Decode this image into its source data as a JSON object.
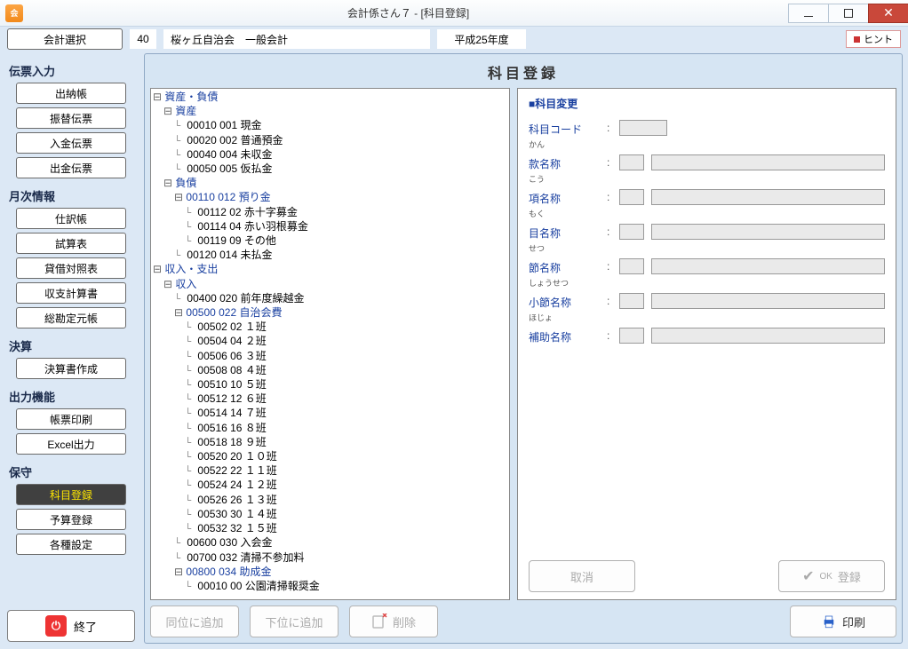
{
  "titlebar": {
    "title": "会計係さん７ - [科目登録]"
  },
  "toprow": {
    "select_btn": "会計選択",
    "org_num": "40",
    "org_name": "桜ヶ丘自治会　一般会計",
    "fiscal_year": "平成25年度",
    "hint": "ヒント"
  },
  "sidebar": {
    "sections": [
      {
        "heading": "伝票入力",
        "items": [
          "出納帳",
          "振替伝票",
          "入金伝票",
          "出金伝票"
        ]
      },
      {
        "heading": "月次情報",
        "items": [
          "仕訳帳",
          "試算表",
          "貸借対照表",
          "収支計算書",
          "総勘定元帳"
        ]
      },
      {
        "heading": "決算",
        "items": [
          "決算書作成"
        ]
      },
      {
        "heading": "出力機能",
        "items": [
          "帳票印刷",
          "Excel出力"
        ]
      },
      {
        "heading": "保守",
        "items": [
          "科目登録",
          "予算登録",
          "各種設定"
        ]
      }
    ],
    "active": "科目登録",
    "exit": "終了"
  },
  "page": {
    "title": "科目登録"
  },
  "tree": [
    {
      "d": 0,
      "t": "⊟",
      "p": true,
      "l": "資産・負債"
    },
    {
      "d": 1,
      "t": "⊟",
      "p": true,
      "l": "資産"
    },
    {
      "d": 2,
      "t": "",
      "p": false,
      "l": "00010 001 現金"
    },
    {
      "d": 2,
      "t": "",
      "p": false,
      "l": "00020 002 普通預金"
    },
    {
      "d": 2,
      "t": "",
      "p": false,
      "l": "00040 004 未収金"
    },
    {
      "d": 2,
      "t": "",
      "p": false,
      "l": "00050 005 仮払金"
    },
    {
      "d": 1,
      "t": "⊟",
      "p": true,
      "l": "負債"
    },
    {
      "d": 2,
      "t": "⊟",
      "p": true,
      "l": "00110 012 預り金"
    },
    {
      "d": 3,
      "t": "",
      "p": false,
      "l": "00112 02 赤十字募金"
    },
    {
      "d": 3,
      "t": "",
      "p": false,
      "l": "00114 04 赤い羽根募金"
    },
    {
      "d": 3,
      "t": "",
      "p": false,
      "l": "00119 09 その他"
    },
    {
      "d": 2,
      "t": "",
      "p": false,
      "l": "00120 014 未払金"
    },
    {
      "d": 0,
      "t": "⊟",
      "p": true,
      "l": "収入・支出"
    },
    {
      "d": 1,
      "t": "⊟",
      "p": true,
      "l": "収入"
    },
    {
      "d": 2,
      "t": "",
      "p": false,
      "l": "00400 020 前年度繰越金"
    },
    {
      "d": 2,
      "t": "⊟",
      "p": true,
      "l": "00500 022 自治会費"
    },
    {
      "d": 3,
      "t": "",
      "p": false,
      "l": "00502 02 １班"
    },
    {
      "d": 3,
      "t": "",
      "p": false,
      "l": "00504 04 ２班"
    },
    {
      "d": 3,
      "t": "",
      "p": false,
      "l": "00506 06 ３班"
    },
    {
      "d": 3,
      "t": "",
      "p": false,
      "l": "00508 08 ４班"
    },
    {
      "d": 3,
      "t": "",
      "p": false,
      "l": "00510 10 ５班"
    },
    {
      "d": 3,
      "t": "",
      "p": false,
      "l": "00512 12 ６班"
    },
    {
      "d": 3,
      "t": "",
      "p": false,
      "l": "00514 14 ７班"
    },
    {
      "d": 3,
      "t": "",
      "p": false,
      "l": "00516 16 ８班"
    },
    {
      "d": 3,
      "t": "",
      "p": false,
      "l": "00518 18 ９班"
    },
    {
      "d": 3,
      "t": "",
      "p": false,
      "l": "00520 20 １０班"
    },
    {
      "d": 3,
      "t": "",
      "p": false,
      "l": "00522 22 １１班"
    },
    {
      "d": 3,
      "t": "",
      "p": false,
      "l": "00524 24 １２班"
    },
    {
      "d": 3,
      "t": "",
      "p": false,
      "l": "00526 26 １３班"
    },
    {
      "d": 3,
      "t": "",
      "p": false,
      "l": "00530 30 １４班"
    },
    {
      "d": 3,
      "t": "",
      "p": false,
      "l": "00532 32 １５班"
    },
    {
      "d": 2,
      "t": "",
      "p": false,
      "l": "00600 030 入会金"
    },
    {
      "d": 2,
      "t": "",
      "p": false,
      "l": "00700 032 清掃不参加料"
    },
    {
      "d": 2,
      "t": "⊟",
      "p": true,
      "l": "00800 034 助成金"
    },
    {
      "d": 3,
      "t": "",
      "p": false,
      "l": "00010 00 公園清掃報奨金"
    }
  ],
  "form": {
    "title": "■科目変更",
    "fields": [
      {
        "ruby": "",
        "label": "科目コード",
        "type": "single"
      },
      {
        "ruby": "かん",
        "label": "款名称",
        "type": "double"
      },
      {
        "ruby": "こう",
        "label": "項名称",
        "type": "double"
      },
      {
        "ruby": "もく",
        "label": "目名称",
        "type": "double"
      },
      {
        "ruby": "せつ",
        "label": "節名称",
        "type": "double"
      },
      {
        "ruby": "しょうせつ",
        "label": "小節名称",
        "type": "double"
      },
      {
        "ruby": "ほじょ",
        "label": "補助名称",
        "type": "double"
      }
    ],
    "cancel": "取消",
    "ok_prefix": "OK",
    "ok": "登録"
  },
  "bottom": {
    "add_same": "同位に追加",
    "add_child": "下位に追加",
    "delete": "削除",
    "print": "印刷"
  }
}
